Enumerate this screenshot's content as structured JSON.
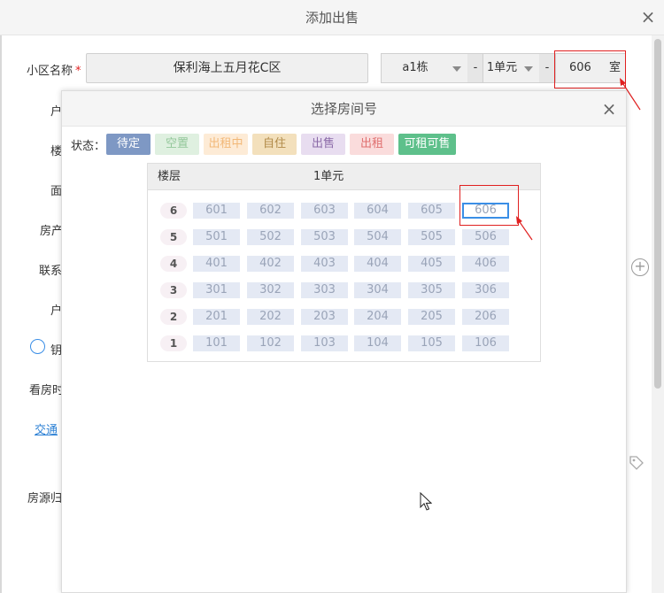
{
  "dialog": {
    "title": "添加出售",
    "close_label": "×"
  },
  "form": {
    "community_label": "小区名称",
    "required_mark": "*",
    "community_value": "保利海上五月花C区",
    "building_value": "a1栋",
    "unit_value": "1单元",
    "separator": "-",
    "room_value": "606",
    "room_suffix": "室",
    "side_labels": [
      "户",
      "楼",
      "面",
      "房产",
      "联系",
      "户",
      "钥",
      "看房时",
      "房源归"
    ],
    "link_text": "交通"
  },
  "room_picker": {
    "title": "选择房间号",
    "close_label": "×",
    "status_label": "状态：",
    "statuses": [
      {
        "label": "待定",
        "bg": "#7e98c4",
        "fg": "#ffffff"
      },
      {
        "label": "空置",
        "bg": "#dff0e0",
        "fg": "#93c79a"
      },
      {
        "label": "出租中",
        "bg": "#fdebd6",
        "fg": "#f2b878"
      },
      {
        "label": "自住",
        "bg": "#f3e0bc",
        "fg": "#b08a48"
      },
      {
        "label": "出售",
        "bg": "#e8ddf0",
        "fg": "#8b6aa8"
      },
      {
        "label": "出租",
        "bg": "#fadcdc",
        "fg": "#e07070"
      },
      {
        "label": "可租可售",
        "bg": "#5ec08b",
        "fg": "#ffffff"
      }
    ],
    "grid": {
      "floor_header": "楼层",
      "unit_header": "1单元",
      "floors": [
        {
          "floor": "6",
          "rooms": [
            "601",
            "602",
            "603",
            "604",
            "605",
            "606"
          ]
        },
        {
          "floor": "5",
          "rooms": [
            "501",
            "502",
            "503",
            "504",
            "505",
            "506"
          ]
        },
        {
          "floor": "4",
          "rooms": [
            "401",
            "402",
            "403",
            "404",
            "405",
            "406"
          ]
        },
        {
          "floor": "3",
          "rooms": [
            "301",
            "302",
            "303",
            "304",
            "305",
            "306"
          ]
        },
        {
          "floor": "2",
          "rooms": [
            "201",
            "202",
            "203",
            "204",
            "205",
            "206"
          ]
        },
        {
          "floor": "1",
          "rooms": [
            "101",
            "102",
            "103",
            "104",
            "105",
            "106"
          ]
        }
      ],
      "selected_room": "606"
    }
  },
  "colors": {
    "accent": "#3a8ee6",
    "annotation_red": "#e02020"
  }
}
